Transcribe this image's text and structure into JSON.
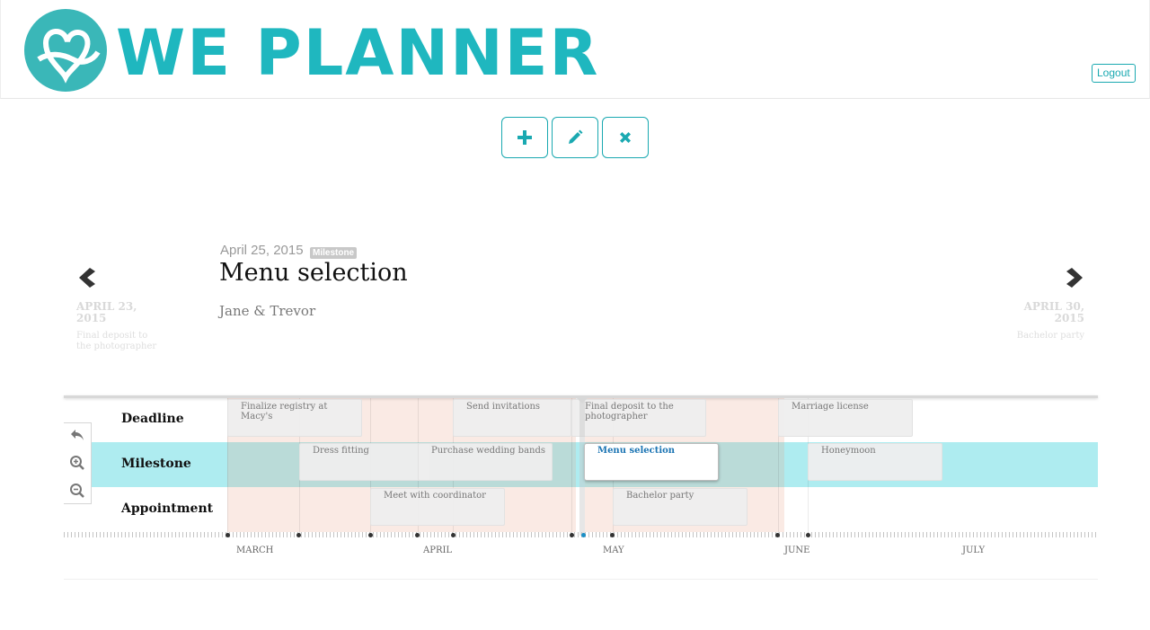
{
  "header": {
    "brand": "WE PLANNER",
    "logout_label": "Logout",
    "logo_icon": "heart-knot-logo-icon"
  },
  "toolbar": {
    "add_icon": "plus-icon",
    "edit_icon": "pencil-icon",
    "delete_icon": "close-icon",
    "accent": "#1aa9b1"
  },
  "slider": {
    "current": {
      "date": "April 25, 2015",
      "badge": "Milestone",
      "title": "Menu selection",
      "subtitle": "Jane & Trevor"
    },
    "prev": {
      "date": "APRIL 23, 2015",
      "description": "Final deposit to the photographer"
    },
    "next": {
      "date": "APRIL 30, 2015",
      "description": "Bachelor party"
    }
  },
  "timeline": {
    "rows": [
      "Deadline",
      "Milestone",
      "Appointment"
    ],
    "highlight_row_color": "#aeecf0",
    "era_color": "#f6e4dc",
    "events": {
      "deadline": [
        "Finalize registry at Macy's",
        "Send invitations",
        "Final deposit to the photographer",
        "Marriage license"
      ],
      "milestone": [
        "Dress fitting",
        "Purchase wedding bands",
        "Menu selection",
        "Honeymoon"
      ],
      "appointment": [
        "Meet with coordinator",
        "Bachelor party"
      ]
    },
    "months": [
      "MARCH",
      "APRIL",
      "MAY",
      "JUNE",
      "JULY"
    ]
  }
}
